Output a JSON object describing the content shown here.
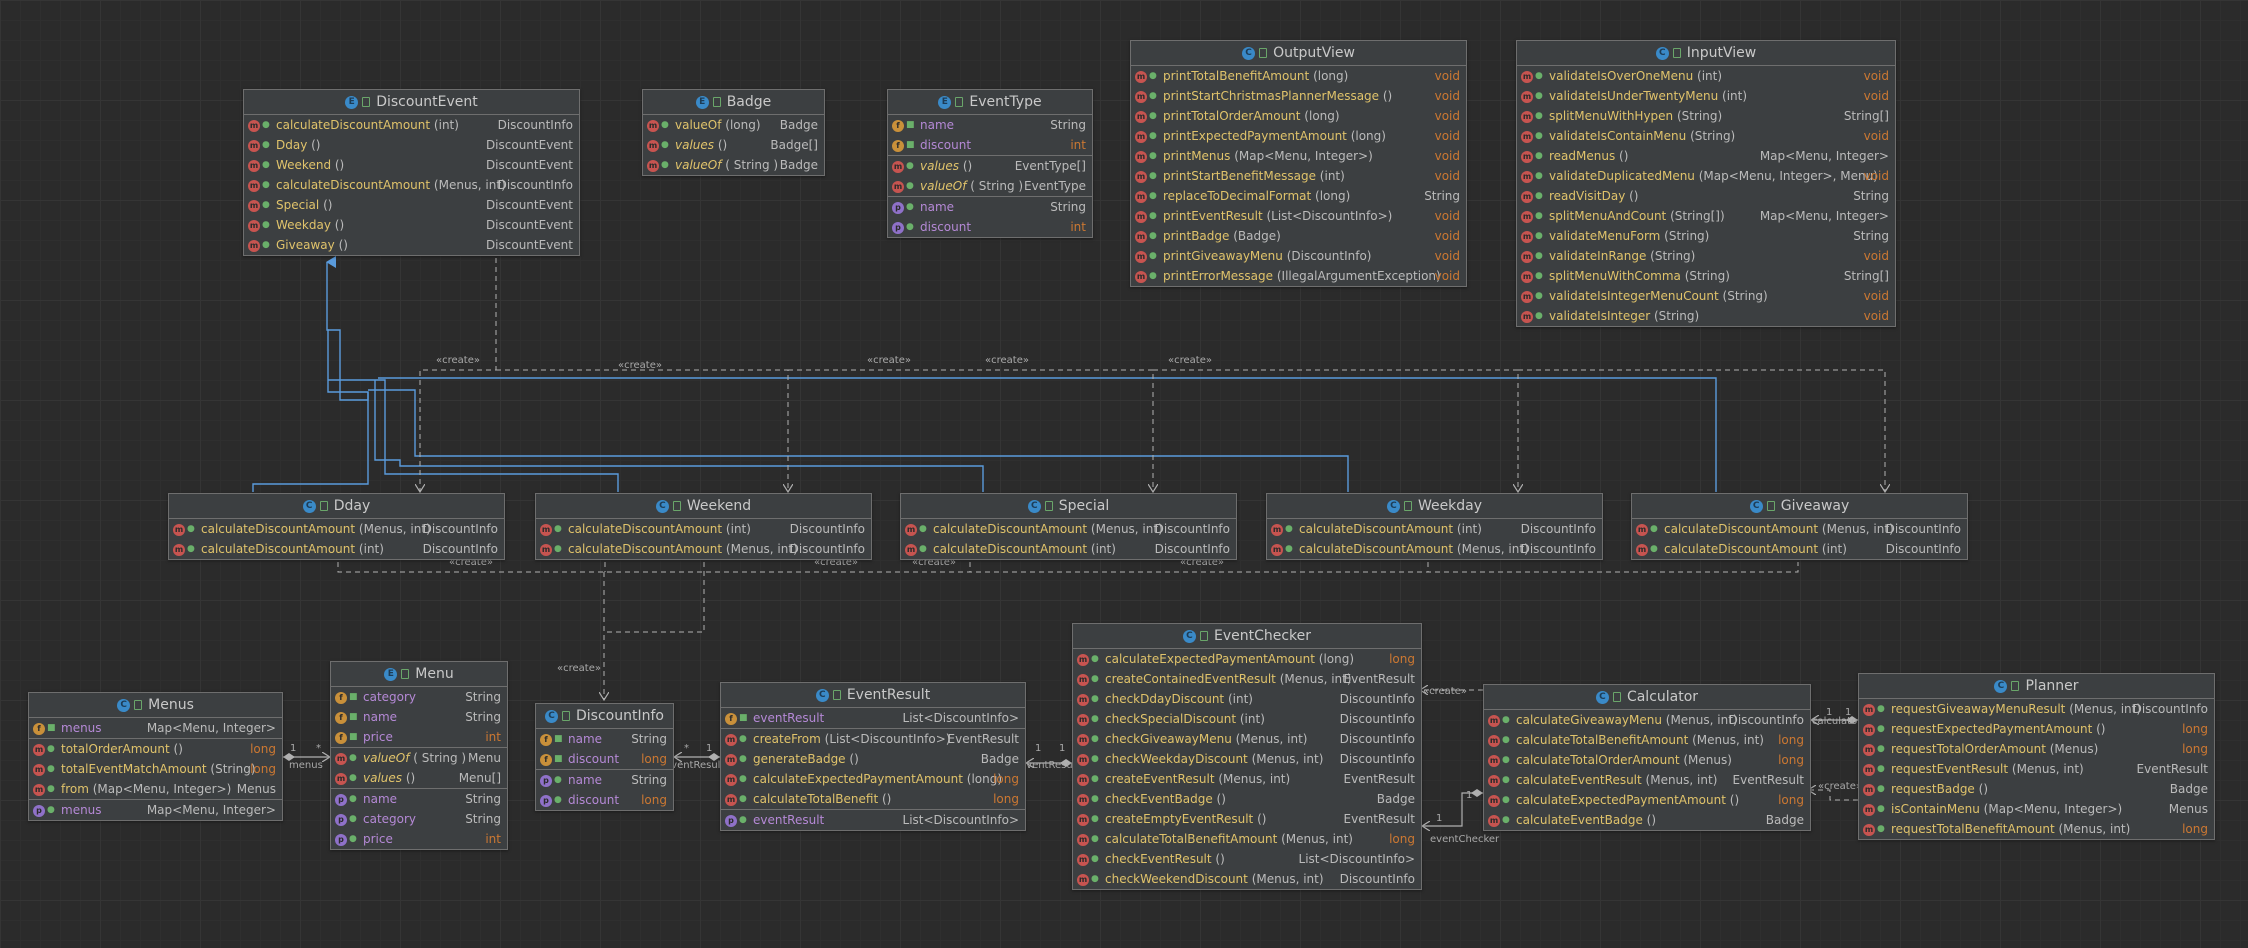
{
  "classes": {
    "discountevent": {
      "title": "DiscountEvent",
      "kind": "E",
      "rows": [
        {
          "icon": "m",
          "name": "calculateDiscountAmount",
          "args": " (int)",
          "ret": "DiscountInfo"
        },
        {
          "icon": "m",
          "name": "Dday",
          "args": " ()",
          "ret": "DiscountEvent"
        },
        {
          "icon": "m",
          "name": "Weekend",
          "args": " ()",
          "ret": "DiscountEvent"
        },
        {
          "icon": "m",
          "name": "calculateDiscountAmount",
          "args": " (Menus, int)",
          "ret": "DiscountInfo"
        },
        {
          "icon": "m",
          "name": "Special",
          "args": " ()",
          "ret": "DiscountEvent"
        },
        {
          "icon": "m",
          "name": "Weekday",
          "args": " ()",
          "ret": "DiscountEvent"
        },
        {
          "icon": "m",
          "name": "Giveaway",
          "args": " ()",
          "ret": "DiscountEvent"
        }
      ]
    },
    "badge": {
      "title": "Badge",
      "kind": "E",
      "rows": [
        {
          "icon": "m",
          "name": "valueOf",
          "args": " (long)",
          "ret": "Badge"
        },
        {
          "icon": "m",
          "name": "values",
          "args": " ()",
          "ret": "Badge[]",
          "italic": true
        },
        {
          "icon": "m",
          "name": "valueOf",
          "args": " ( String )",
          "ret": "Badge",
          "italic": true
        }
      ]
    },
    "eventtype": {
      "title": "EventType",
      "kind": "E",
      "sections": [
        [
          {
            "icon": "f",
            "name": "name",
            "ret": "String",
            "field": true
          },
          {
            "icon": "f",
            "name": "discount",
            "ret": "int",
            "field": true,
            "retkw": true
          }
        ],
        [
          {
            "icon": "m",
            "name": "values",
            "args": " ()",
            "ret": "EventType[]",
            "italic": true
          },
          {
            "icon": "m",
            "name": "valueOf",
            "args": " ( String )",
            "ret": "EventType",
            "italic": true
          }
        ],
        [
          {
            "icon": "p",
            "name": "name",
            "ret": "String",
            "field": true
          },
          {
            "icon": "p",
            "name": "discount",
            "ret": "int",
            "field": true,
            "retkw": true
          }
        ]
      ]
    },
    "outputview": {
      "title": "OutputView",
      "kind": "C",
      "rows": [
        {
          "icon": "m",
          "name": "printTotalBenefitAmount",
          "args": " (long)",
          "ret": "void",
          "retkw": true
        },
        {
          "icon": "m",
          "name": "printStartChristmasPlannerMessage",
          "args": " ()",
          "ret": "void",
          "retkw": true
        },
        {
          "icon": "m",
          "name": "printTotalOrderAmount",
          "args": " (long)",
          "ret": "void",
          "retkw": true
        },
        {
          "icon": "m",
          "name": "printExpectedPaymentAmount",
          "args": " (long)",
          "ret": "void",
          "retkw": true
        },
        {
          "icon": "m",
          "name": "printMenus",
          "args": " (Map<Menu, Integer>)",
          "ret": "void",
          "retkw": true
        },
        {
          "icon": "m",
          "name": "printStartBenefitMessage",
          "args": " (int)",
          "ret": "void",
          "retkw": true
        },
        {
          "icon": "m",
          "name": "replaceToDecimalFormat",
          "args": " (long)",
          "ret": "String"
        },
        {
          "icon": "m",
          "name": "printEventResult",
          "args": " (List<DiscountInfo>)",
          "ret": "void",
          "retkw": true
        },
        {
          "icon": "m",
          "name": "printBadge",
          "args": " (Badge)",
          "ret": "void",
          "retkw": true
        },
        {
          "icon": "m",
          "name": "printGiveawayMenu",
          "args": " (DiscountInfo)",
          "ret": "void",
          "retkw": true
        },
        {
          "icon": "m",
          "name": "printErrorMessage",
          "args": " (IllegalArgumentException)",
          "ret": "void",
          "retkw": true
        }
      ]
    },
    "inputview": {
      "title": "InputView",
      "kind": "C",
      "rows": [
        {
          "icon": "m",
          "name": "validateIsOverOneMenu",
          "args": " (int)",
          "ret": "void",
          "retkw": true
        },
        {
          "icon": "m",
          "name": "validateIsUnderTwentyMenu",
          "args": " (int)",
          "ret": "void",
          "retkw": true
        },
        {
          "icon": "m",
          "name": "splitMenuWithHypen",
          "args": " (String)",
          "ret": "String[]"
        },
        {
          "icon": "m",
          "name": "validateIsContainMenu",
          "args": " (String)",
          "ret": "void",
          "retkw": true
        },
        {
          "icon": "m",
          "name": "readMenus",
          "args": " ()",
          "ret": "Map<Menu, Integer>"
        },
        {
          "icon": "m",
          "name": "validateDuplicatedMenu",
          "args": " (Map<Menu, Integer>, Menu)",
          "ret": "void",
          "retkw": true
        },
        {
          "icon": "m",
          "name": "readVisitDay",
          "args": " ()",
          "ret": "String"
        },
        {
          "icon": "m",
          "name": "splitMenuAndCount",
          "args": " (String[])",
          "ret": "Map<Menu, Integer>"
        },
        {
          "icon": "m",
          "name": "validateMenuForm",
          "args": " (String)",
          "ret": "String"
        },
        {
          "icon": "m",
          "name": "validateInRange",
          "args": " (String)",
          "ret": "void",
          "retkw": true
        },
        {
          "icon": "m",
          "name": "splitMenuWithComma",
          "args": " (String)",
          "ret": "String[]"
        },
        {
          "icon": "m",
          "name": "validateIsIntegerMenuCount",
          "args": " (String)",
          "ret": "void",
          "retkw": true
        },
        {
          "icon": "m",
          "name": "validateIsInteger",
          "args": " (String)",
          "ret": "void",
          "retkw": true
        }
      ]
    },
    "dday": {
      "title": "Dday",
      "kind": "C",
      "rows": [
        {
          "icon": "m",
          "name": "calculateDiscountAmount",
          "args": " (Menus, int)",
          "ret": "DiscountInfo"
        },
        {
          "icon": "m",
          "name": "calculateDiscountAmount",
          "args": " (int)",
          "ret": "DiscountInfo"
        }
      ]
    },
    "weekend": {
      "title": "Weekend",
      "kind": "C",
      "rows": [
        {
          "icon": "m",
          "name": "calculateDiscountAmount",
          "args": " (int)",
          "ret": "DiscountInfo"
        },
        {
          "icon": "m",
          "name": "calculateDiscountAmount",
          "args": " (Menus, int)",
          "ret": "DiscountInfo"
        }
      ]
    },
    "special": {
      "title": "Special",
      "kind": "C",
      "rows": [
        {
          "icon": "m",
          "name": "calculateDiscountAmount",
          "args": " (Menus, int)",
          "ret": "DiscountInfo"
        },
        {
          "icon": "m",
          "name": "calculateDiscountAmount",
          "args": " (int)",
          "ret": "DiscountInfo"
        }
      ]
    },
    "weekday": {
      "title": "Weekday",
      "kind": "C",
      "rows": [
        {
          "icon": "m",
          "name": "calculateDiscountAmount",
          "args": " (int)",
          "ret": "DiscountInfo"
        },
        {
          "icon": "m",
          "name": "calculateDiscountAmount",
          "args": " (Menus, int)",
          "ret": "DiscountInfo"
        }
      ]
    },
    "giveaway": {
      "title": "Giveaway",
      "kind": "C",
      "rows": [
        {
          "icon": "m",
          "name": "calculateDiscountAmount",
          "args": " (Menus, int)",
          "ret": "DiscountInfo"
        },
        {
          "icon": "m",
          "name": "calculateDiscountAmount",
          "args": " (int)",
          "ret": "DiscountInfo"
        }
      ]
    },
    "menus": {
      "title": "Menus",
      "kind": "C",
      "sections": [
        [
          {
            "icon": "f",
            "name": "menus",
            "ret": "Map<Menu, Integer>",
            "field": true
          }
        ],
        [
          {
            "icon": "m",
            "name": "totalOrderAmount",
            "args": " ()",
            "ret": "long",
            "retkw": true
          },
          {
            "icon": "m",
            "name": "totalEventMatchAmount",
            "args": " (String)",
            "ret": "long",
            "retkw": true
          },
          {
            "icon": "m",
            "name": "from",
            "args": " (Map<Menu, Integer>)",
            "ret": "Menus"
          }
        ],
        [
          {
            "icon": "p",
            "name": "menus",
            "ret": "Map<Menu, Integer>",
            "field": true
          }
        ]
      ]
    },
    "menu": {
      "title": "Menu",
      "kind": "E",
      "sections": [
        [
          {
            "icon": "f",
            "name": "category",
            "ret": "String",
            "field": true
          },
          {
            "icon": "f",
            "name": "name",
            "ret": "String",
            "field": true
          },
          {
            "icon": "f",
            "name": "price",
            "ret": "int",
            "field": true,
            "retkw": true
          }
        ],
        [
          {
            "icon": "m",
            "name": "valueOf",
            "args": " ( String )",
            "ret": "Menu",
            "italic": true
          },
          {
            "icon": "m",
            "name": "values",
            "args": " ()",
            "ret": "Menu[]",
            "italic": true
          }
        ],
        [
          {
            "icon": "p",
            "name": "name",
            "ret": "String",
            "field": true
          },
          {
            "icon": "p",
            "name": "category",
            "ret": "String",
            "field": true
          },
          {
            "icon": "p",
            "name": "price",
            "ret": "int",
            "field": true,
            "retkw": true
          }
        ]
      ]
    },
    "discountinfo": {
      "title": "DiscountInfo",
      "kind": "C",
      "sections": [
        [
          {
            "icon": "f",
            "name": "name",
            "ret": "String",
            "field": true
          },
          {
            "icon": "f",
            "name": "discount",
            "ret": "long",
            "field": true,
            "retkw": true
          }
        ],
        [
          {
            "icon": "p",
            "name": "name",
            "ret": "String",
            "field": true
          },
          {
            "icon": "p",
            "name": "discount",
            "ret": "long",
            "field": true,
            "retkw": true
          }
        ]
      ]
    },
    "eventresult": {
      "title": "EventResult",
      "kind": "C",
      "sections": [
        [
          {
            "icon": "f",
            "name": "eventResult",
            "ret": "List<DiscountInfo>",
            "field": true
          }
        ],
        [
          {
            "icon": "m",
            "name": "createFrom",
            "args": " (List<DiscountInfo>)",
            "ret": "EventResult"
          },
          {
            "icon": "m",
            "name": "generateBadge",
            "args": " ()",
            "ret": "Badge"
          },
          {
            "icon": "m",
            "name": "calculateExpectedPaymentAmount",
            "args": " (long)",
            "ret": "long",
            "retkw": true
          },
          {
            "icon": "m",
            "name": "calculateTotalBenefit",
            "args": " ()",
            "ret": "long",
            "retkw": true
          }
        ],
        [
          {
            "icon": "p",
            "name": "eventResult",
            "ret": "List<DiscountInfo>",
            "field": true
          }
        ]
      ]
    },
    "eventchecker": {
      "title": "EventChecker",
      "kind": "C",
      "rows": [
        {
          "icon": "m",
          "name": "calculateExpectedPaymentAmount",
          "args": " (long)",
          "ret": "long",
          "retkw": true
        },
        {
          "icon": "m",
          "name": "createContainedEventResult",
          "args": " (Menus, int)",
          "ret": "EventResult"
        },
        {
          "icon": "m",
          "name": "checkDdayDiscount",
          "args": " (int)",
          "ret": "DiscountInfo"
        },
        {
          "icon": "m",
          "name": "checkSpecialDiscount",
          "args": " (int)",
          "ret": "DiscountInfo"
        },
        {
          "icon": "m",
          "name": "checkGiveawayMenu",
          "args": " (Menus, int)",
          "ret": "DiscountInfo"
        },
        {
          "icon": "m",
          "name": "checkWeekdayDiscount",
          "args": " (Menus, int)",
          "ret": "DiscountInfo"
        },
        {
          "icon": "m",
          "name": "createEventResult",
          "args": " (Menus, int)",
          "ret": "EventResult"
        },
        {
          "icon": "m",
          "name": "checkEventBadge",
          "args": " ()",
          "ret": "Badge"
        },
        {
          "icon": "m",
          "name": "createEmptyEventResult",
          "args": " ()",
          "ret": "EventResult"
        },
        {
          "icon": "m",
          "name": "calculateTotalBenefitAmount",
          "args": " (Menus, int)",
          "ret": "long",
          "retkw": true
        },
        {
          "icon": "m",
          "name": "checkEventResult",
          "args": " ()",
          "ret": "List<DiscountInfo>"
        },
        {
          "icon": "m",
          "name": "checkWeekendDiscount",
          "args": " (Menus, int)",
          "ret": "DiscountInfo"
        }
      ]
    },
    "calculator": {
      "title": "Calculator",
      "kind": "C",
      "rows": [
        {
          "icon": "m",
          "name": "calculateGiveawayMenu",
          "args": " (Menus, int)",
          "ret": "DiscountInfo"
        },
        {
          "icon": "m",
          "name": "calculateTotalBenefitAmount",
          "args": " (Menus, int)",
          "ret": "long",
          "retkw": true
        },
        {
          "icon": "m",
          "name": "calculateTotalOrderAmount",
          "args": " (Menus)",
          "ret": "long",
          "retkw": true
        },
        {
          "icon": "m",
          "name": "calculateEventResult",
          "args": " (Menus, int)",
          "ret": "EventResult"
        },
        {
          "icon": "m",
          "name": "calculateExpectedPaymentAmount",
          "args": " ()",
          "ret": "long",
          "retkw": true
        },
        {
          "icon": "m",
          "name": "calculateEventBadge",
          "args": " ()",
          "ret": "Badge"
        }
      ]
    },
    "planner": {
      "title": "Planner",
      "kind": "C",
      "rows": [
        {
          "icon": "m",
          "name": "requestGiveawayMenuResult",
          "args": " (Menus, int)",
          "ret": "DiscountInfo"
        },
        {
          "icon": "m",
          "name": "requestExpectedPaymentAmount",
          "args": " ()",
          "ret": "long",
          "retkw": true
        },
        {
          "icon": "m",
          "name": "requestTotalOrderAmount",
          "args": " (Menus)",
          "ret": "long",
          "retkw": true
        },
        {
          "icon": "m",
          "name": "requestEventResult",
          "args": " (Menus, int)",
          "ret": "EventResult"
        },
        {
          "icon": "m",
          "name": "requestBadge",
          "args": " ()",
          "ret": "Badge"
        },
        {
          "icon": "m",
          "name": "isContainMenu",
          "args": " (Map<Menu, Integer>)",
          "ret": "Menus"
        },
        {
          "icon": "m",
          "name": "requestTotalBenefitAmount",
          "args": " (Menus, int)",
          "ret": "long",
          "retkw": true
        }
      ]
    }
  },
  "labels": {
    "create": "«create»",
    "one": "1",
    "many": "*",
    "menus_role": "menus",
    "eventresult_role": "eventResult",
    "eventchecker_role": "eventChecker",
    "calculator_role": "calculator"
  },
  "colors": {
    "background": "#2b2b2b",
    "box": "#3c3f41",
    "border": "#6e6e6e",
    "method_icon": "#c75450",
    "field_icon": "#c9903a",
    "property_icon": "#8f71c9",
    "class_icon": "#3a8ac8",
    "inherit_edge": "#5a9bdc",
    "dependency_edge": "#b0b0b0"
  }
}
